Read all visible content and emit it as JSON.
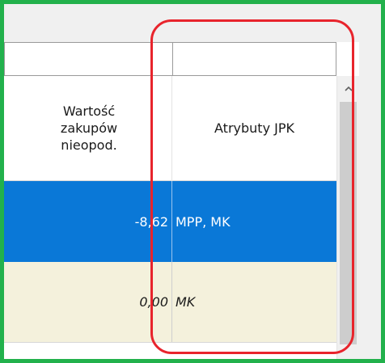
{
  "grid": {
    "columns": {
      "wartosc_line1": "Wartość",
      "wartosc_line2": "zakupów",
      "wartosc_line3": "nieopod.",
      "atrybuty": "Atrybuty JPK"
    },
    "rows": [
      {
        "value": "-8,62",
        "attributes": "MPP, MK",
        "selected": true
      },
      {
        "value": "0,00",
        "attributes": "MK",
        "selected": false
      }
    ]
  },
  "scrollbar": {
    "up_icon": "chevron-up-icon"
  },
  "colors": {
    "frame": "#22b14c",
    "annotation": "#e8242c",
    "selected_row": "#0a78d7",
    "normal_row": "#f4f1dc"
  }
}
